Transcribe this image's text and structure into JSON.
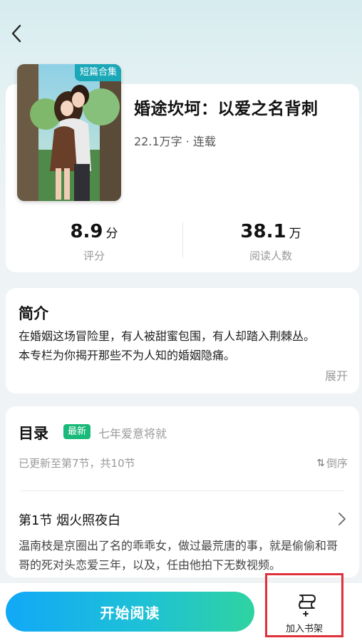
{
  "book": {
    "cover_badge": "短篇合集",
    "title": "婚途坎坷：以爱之名背刺",
    "meta": "22.1万字 · 连载",
    "stats": [
      {
        "value": "8.9",
        "unit": "分",
        "label": "评分"
      },
      {
        "value": "38.1",
        "unit": "万",
        "label": "阅读人数"
      }
    ]
  },
  "intro": {
    "heading": "简介",
    "line1": "在婚姻这场冒险里，有人被甜蜜包围，有人却踏入荆棘丛。",
    "line2": "本专栏为你揭开那些不为人知的婚姻隐痛。",
    "expand_label": "展开"
  },
  "toc": {
    "heading": "目录",
    "new_badge": "最新",
    "latest_chapter": "七年爱意将就",
    "update_info": "已更新至第7节，共10节",
    "sort_label": "倒序",
    "first_chapter": {
      "title": "第1节 烟火照夜白",
      "summary": "温南枝是京圈出了名的乖乖女，做过最荒唐的事，就是偷偷和哥哥的死对头恋爱三年，以及，任由他拍下无数视频。"
    }
  },
  "bottom": {
    "read_label": "开始阅读",
    "shelf_label": "加入书架"
  },
  "colors": {
    "accent_start": "#12a8f7",
    "accent_end": "#2fd3a1",
    "new_badge": "#19b97a",
    "highlight_box": "#e0313b"
  },
  "icons": [
    "back-arrow-icon",
    "chevron-right-icon",
    "sort-icon",
    "bookshelf-add-icon"
  ]
}
